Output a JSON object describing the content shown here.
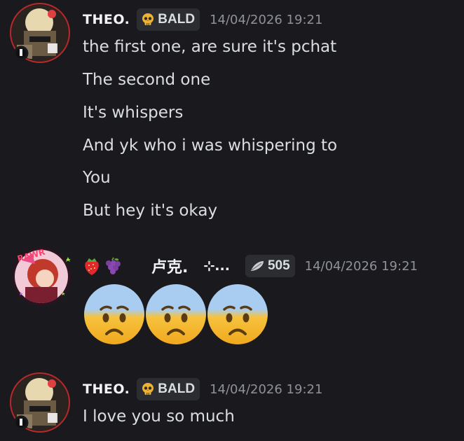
{
  "messages": [
    {
      "author": "THEO.",
      "tag": "BALD",
      "tag_icon": "skull-icon",
      "timestamp": "14/04/2026 19:21",
      "lines": [
        "the first one, are sure it's pchat",
        "The second one",
        "It's whispers",
        "And yk who i was whispering to",
        "You",
        "But hey it's okay"
      ]
    },
    {
      "author_emojis": [
        "strawberry-icon",
        "grapes-icon"
      ],
      "author": "卢克.",
      "author_suffix": "⊹...",
      "tag": "505",
      "tag_icon": "feather-icon",
      "timestamp": "14/04/2026 19:21",
      "content_emojis": [
        "anxious-face-with-sweat-icon",
        "anxious-face-with-sweat-icon",
        "anxious-face-with-sweat-icon"
      ]
    },
    {
      "author": "THEO.",
      "tag": "BALD",
      "tag_icon": "skull-icon",
      "timestamp": "14/04/2026 19:21",
      "lines": [
        "I love you so much"
      ]
    }
  ],
  "colors": {
    "background": "#1a1a1e",
    "text": "#dbdee1",
    "username": "#f2f3f5",
    "timestamp": "#8e9297",
    "tag_bg": "#2b2d31",
    "skull": "#f0b232",
    "emoji_face": "#f7c23c",
    "emoji_forehead": "#a9cdf0"
  }
}
